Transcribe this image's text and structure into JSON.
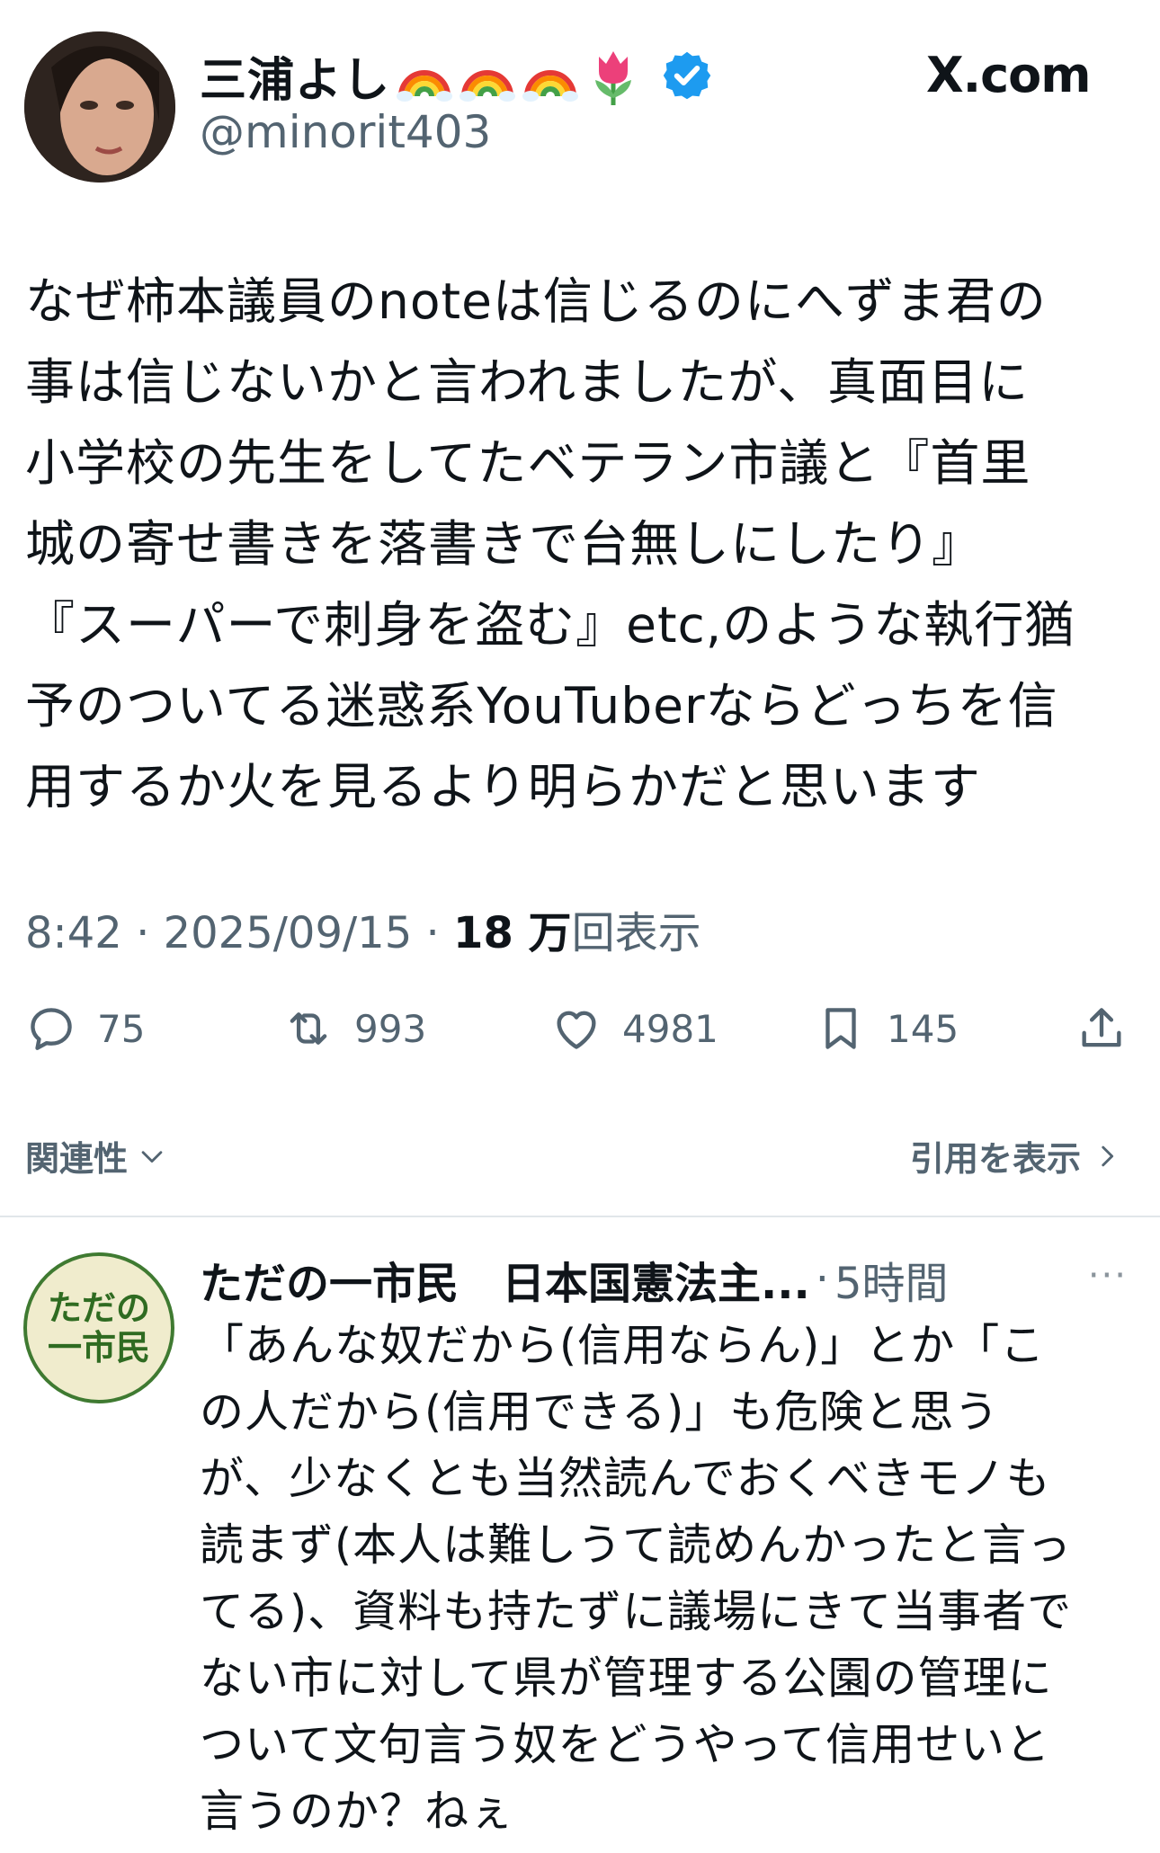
{
  "author": {
    "display_name": "三浦よし",
    "name_emojis": [
      "rainbow-emoji",
      "rainbow-emoji",
      "rainbow-emoji",
      "tulip-emoji"
    ],
    "verified": true,
    "handle": "@minorit403"
  },
  "site_label": "X.com",
  "tweet": {
    "text": "なぜ柿本議員のnoteは信じるのにへずま君の\n事は信じないかと言われましたが、真面目に\n小学校の先生をしてたベテラン市議と『首里\n城の寄せ書きを落書きで台無しにしたり』\n『スーパーで刺身を盗む』etc,のような執行猶\n予のついてる迷惑系YouTuberならどっちを信\n用するか火を見るより明らかだと思います",
    "time": "8:42",
    "date": "2025/09/15",
    "separator": "·",
    "views_count": "18 万",
    "views_label": "回表示"
  },
  "actions": {
    "replies": "75",
    "retweets": "993",
    "likes": "4981",
    "bookmarks": "145"
  },
  "related_label": "関連性",
  "quotes_label": "引用を表示",
  "reply": {
    "avatar_text_line1": "ただの",
    "avatar_text_line2": "一市民",
    "name": "ただの一市民　日本国憲法主...",
    "separator": "·",
    "time": "5時間",
    "more": "···",
    "text": "「あんな奴だから(信用ならん)」とか「こ\nの人だから(信用できる)」も危険と思う\nが、少なくとも当然読んでおくべきモノも\n読まず(本人は難しうて読めんかったと言っ\nてる)、資料も持たずに議場にきて当事者で\nない市に対して県が管理する公園の管理に\nついて文句言う奴をどうやって信用せいと\n言うのか？ねぇ"
  },
  "colors": {
    "text": "#0f1419",
    "muted": "#536471",
    "verified_blue": "#1d9bf0",
    "divider": "#e1e6ea",
    "reply_avatar_green": "#3f7a31",
    "reply_avatar_bg": "#f0eccd"
  }
}
